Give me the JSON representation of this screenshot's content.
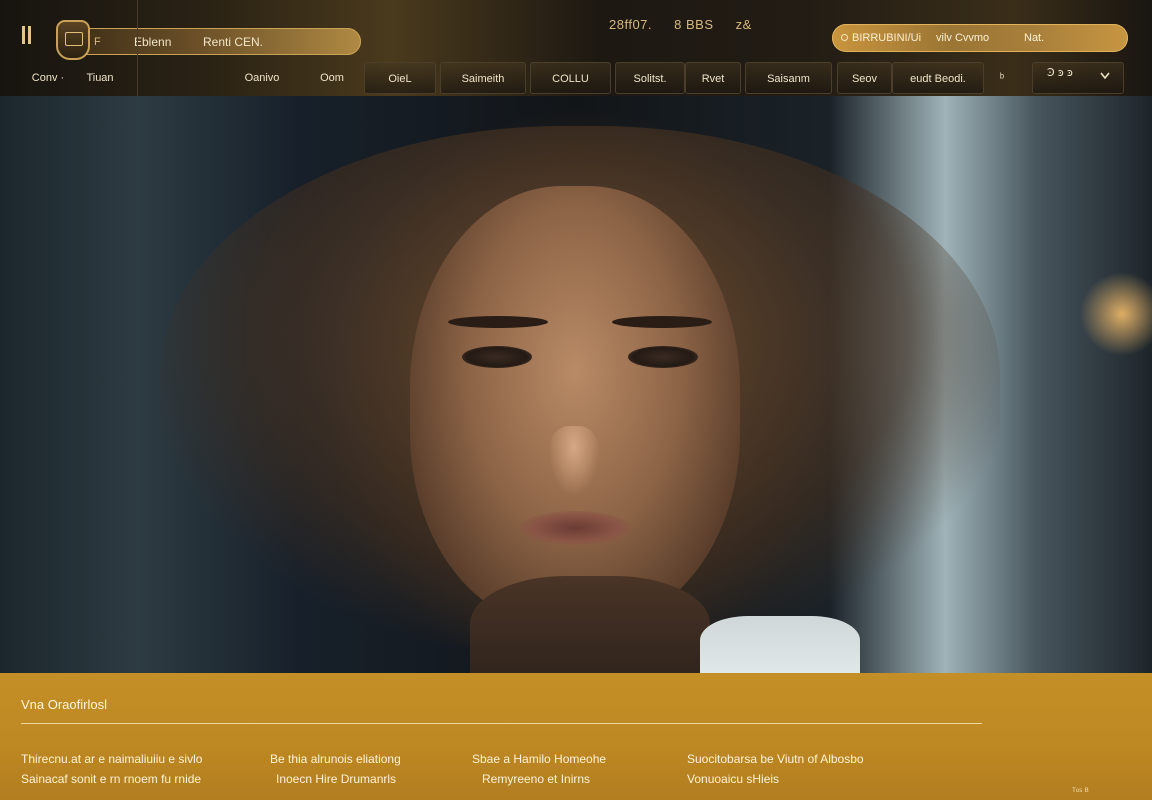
{
  "header": {
    "brand_mark": "F",
    "brand_name": "Eblenn",
    "brand_sub": "Renti CEN.",
    "stats": [
      "28ff07.",
      "8 BBS",
      "z&"
    ],
    "alert": {
      "text": "BIRRUBINI/Ui",
      "link": "vilv Cvvmo",
      "end": "Nat."
    }
  },
  "nav": {
    "items": [
      "Conv ·",
      "Tiuan",
      "Oanivo",
      "Oom",
      "OieL",
      "Saimeith",
      "COLLU",
      "Solitst.",
      "Rvet",
      "Saisanm",
      "Seov",
      "eudt Beodi.",
      "ᵇ",
      "Ꜿ ꜿ ꜿ"
    ]
  },
  "footer": {
    "title": "Vna Oraofirlosl",
    "columns": [
      [
        "Thirecnu.at ar e naimaliuiiu e sivlo",
        "Sainacaf sonit e rn rnoem fu rnide"
      ],
      [
        "Be thia alrunois eliationg",
        "Inoecn Hire Drumanrls"
      ],
      [
        "Sbae a Hamilo Homeohe",
        "Remyreeno et Inirns"
      ],
      [
        "Suocitobarsa be Viutn of Albosbo",
        "Vonuoaicu sHieis"
      ]
    ],
    "mark": "ᵀᵒˢ ᴮ"
  },
  "colors": {
    "accent": "#c58f27",
    "header_bg": "#1d1812",
    "gold_text": "#d6b97f"
  }
}
